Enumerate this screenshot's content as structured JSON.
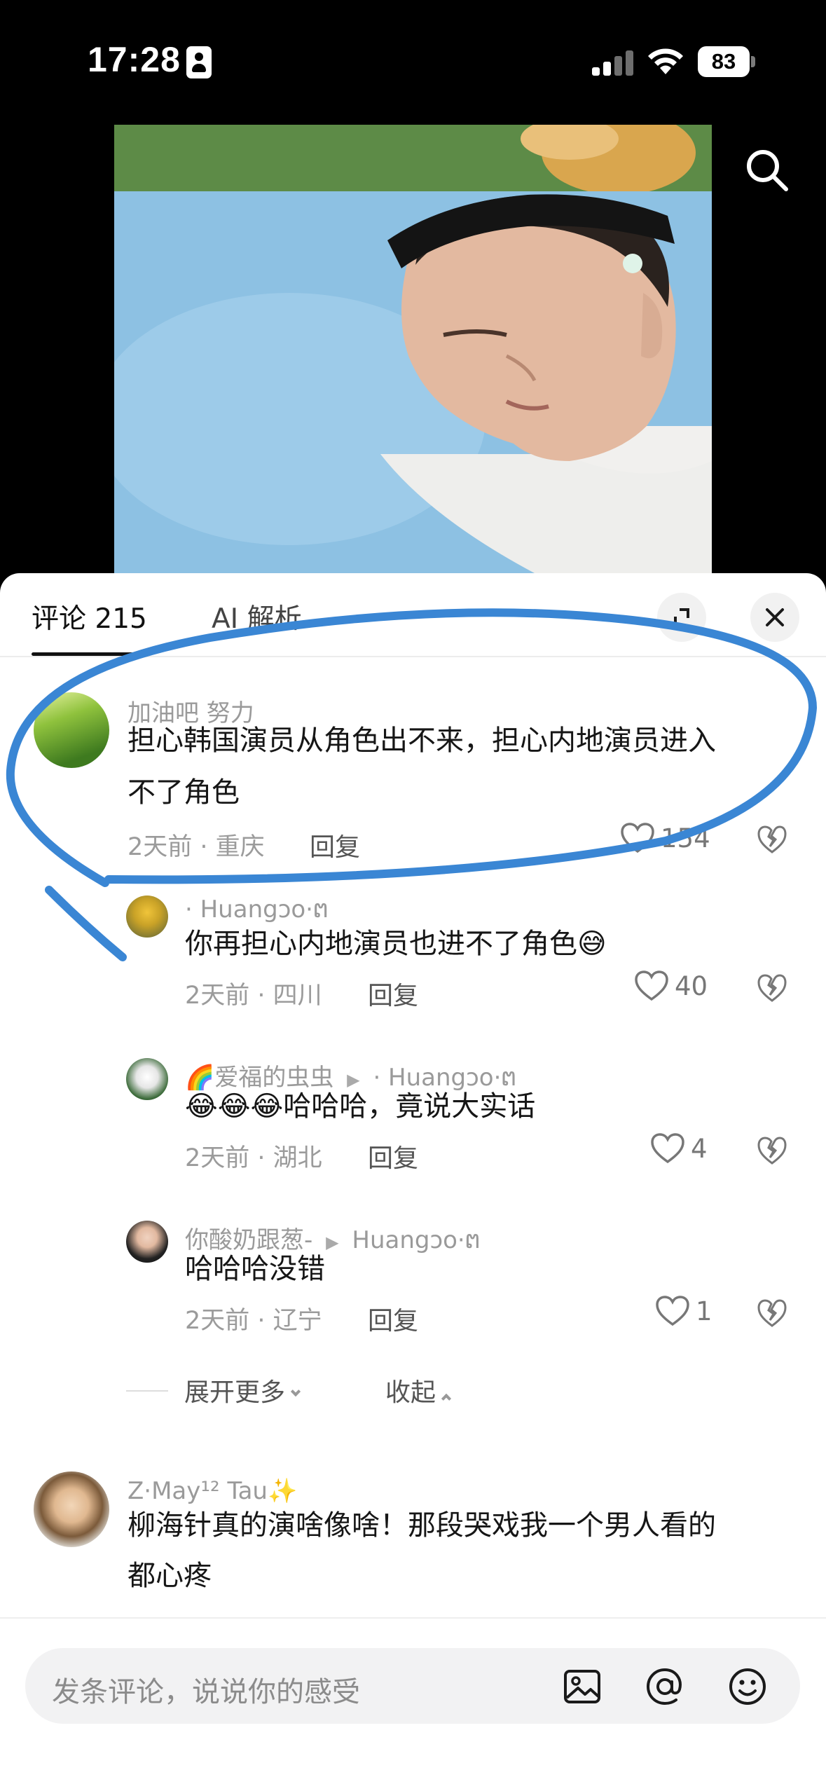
{
  "status_bar": {
    "time": "17:28",
    "battery": "83"
  },
  "tabs": {
    "comments_label": "评论 215",
    "ai_label": "AI 解析"
  },
  "comments": [
    {
      "username": "加油吧 努力",
      "text_line1": "担心韩国演员从角色出不来，担心内地演员进入",
      "text_line2": "不了角色",
      "time_location": "2天前 · 重庆",
      "reply_label": "回复",
      "likes": "154"
    },
    {
      "username": "· Huangɔo·ຕ",
      "text": "你再担心内地演员也进不了角色😅",
      "time_location": "2天前 · 四川",
      "reply_label": "回复",
      "likes": "40"
    },
    {
      "username": "🌈爱福的虫虫",
      "reply_to": "· Huangɔo·ຕ",
      "text": "😂😂😂哈哈哈，竟说大实话",
      "time_location": "2天前 · 湖北",
      "reply_label": "回复",
      "likes": "4"
    },
    {
      "username": "你酸奶跟葱-",
      "reply_to": "Huangɔo·ຕ",
      "text": "哈哈哈没错",
      "time_location": "2天前 · 辽宁",
      "reply_label": "回复",
      "likes": "1"
    },
    {
      "username": "Z·May¹² Tau✨",
      "text_line1": "柳海针真的演啥像啥！那段哭戏我一个男人看的",
      "text_line2": "都心疼"
    }
  ],
  "replies_controls": {
    "expand_more": "展开更多",
    "collapse": "收起"
  },
  "input": {
    "placeholder": "发条评论，说说你的感受"
  },
  "colors": {
    "annotation_stroke": "#3a86d4",
    "panel_bg": "#ffffff",
    "icon": "#1a1a1a"
  }
}
